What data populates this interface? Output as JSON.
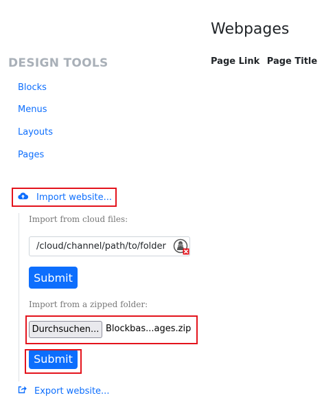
{
  "main": {
    "title": "Webpages",
    "columns": [
      "Page Link",
      "Page Title"
    ]
  },
  "sidebar": {
    "heading": "DESIGN TOOLS",
    "items": [
      {
        "label": "Blocks"
      },
      {
        "label": "Menus"
      },
      {
        "label": "Layouts"
      },
      {
        "label": "Pages"
      }
    ],
    "import_label": "Import website...",
    "import_icon": "cloud-upload-icon",
    "export_label": "Export website...",
    "export_icon": "share-export-icon"
  },
  "import_panel": {
    "cloud_label": "Import from cloud files:",
    "cloud_path": "/cloud/channel/path/to/folder",
    "cloud_field_icon": "user-lock-icon",
    "submit_label": "Submit",
    "zip_label": "Import from a zipped folder:",
    "browse_label": "Durchsuchen...",
    "file_name": "Blockbas...ages.zip",
    "submit2_label": "Submit"
  },
  "colors": {
    "link": "#0d6efd",
    "primary": "#0d6efd",
    "highlight": "#e3121b",
    "heading_muted": "#a9b0b8"
  }
}
